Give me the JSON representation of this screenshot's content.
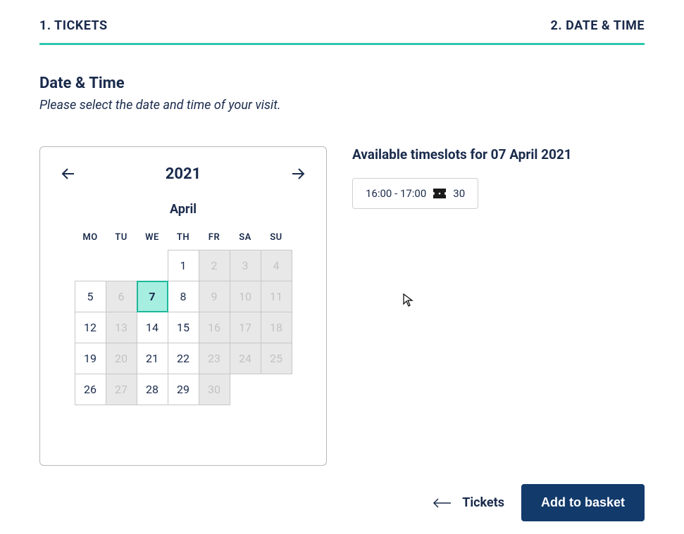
{
  "tabs": {
    "tickets": "1. TICKETS",
    "datetime": "2. DATE & TIME"
  },
  "section": {
    "title": "Date & Time",
    "subtitle": "Please select the date and time of your visit."
  },
  "calendar": {
    "year": "2021",
    "month": "April",
    "weekdays": [
      "MO",
      "TU",
      "WE",
      "TH",
      "FR",
      "SA",
      "SU"
    ],
    "cells": [
      {
        "n": "",
        "state": "empty"
      },
      {
        "n": "",
        "state": "empty"
      },
      {
        "n": "",
        "state": "empty"
      },
      {
        "n": "1",
        "state": "avail"
      },
      {
        "n": "2",
        "state": "disabled"
      },
      {
        "n": "3",
        "state": "disabled"
      },
      {
        "n": "4",
        "state": "disabled"
      },
      {
        "n": "5",
        "state": "avail"
      },
      {
        "n": "6",
        "state": "disabled"
      },
      {
        "n": "7",
        "state": "selected"
      },
      {
        "n": "8",
        "state": "avail"
      },
      {
        "n": "9",
        "state": "disabled"
      },
      {
        "n": "10",
        "state": "disabled"
      },
      {
        "n": "11",
        "state": "disabled"
      },
      {
        "n": "12",
        "state": "avail"
      },
      {
        "n": "13",
        "state": "disabled"
      },
      {
        "n": "14",
        "state": "avail"
      },
      {
        "n": "15",
        "state": "avail"
      },
      {
        "n": "16",
        "state": "disabled"
      },
      {
        "n": "17",
        "state": "disabled"
      },
      {
        "n": "18",
        "state": "disabled"
      },
      {
        "n": "19",
        "state": "avail"
      },
      {
        "n": "20",
        "state": "disabled"
      },
      {
        "n": "21",
        "state": "avail"
      },
      {
        "n": "22",
        "state": "avail"
      },
      {
        "n": "23",
        "state": "disabled"
      },
      {
        "n": "24",
        "state": "disabled"
      },
      {
        "n": "25",
        "state": "disabled"
      },
      {
        "n": "26",
        "state": "avail"
      },
      {
        "n": "27",
        "state": "disabled"
      },
      {
        "n": "28",
        "state": "avail"
      },
      {
        "n": "29",
        "state": "avail"
      },
      {
        "n": "30",
        "state": "disabled"
      }
    ]
  },
  "timeslots": {
    "heading": "Available timeslots for 07 April 2021",
    "items": [
      {
        "range": "16:00 - 17:00",
        "count": "30"
      }
    ]
  },
  "footer": {
    "back": "Tickets",
    "cta": "Add to basket"
  }
}
